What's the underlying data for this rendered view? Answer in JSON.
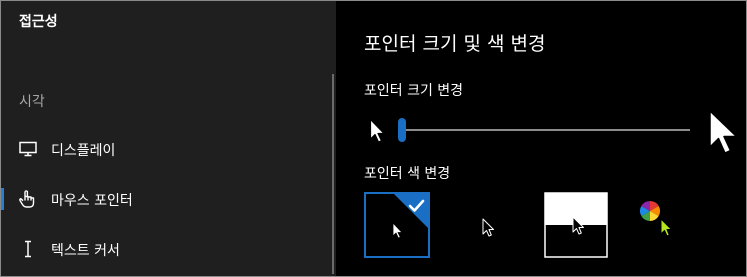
{
  "sidebar": {
    "title": "접근성",
    "section": "시각",
    "items": [
      {
        "label": "디스플레이",
        "icon": "monitor-icon",
        "active": false
      },
      {
        "label": "마우스 포인터",
        "icon": "hand-pointer-icon",
        "active": true
      },
      {
        "label": "텍스트 커서",
        "icon": "text-cursor-icon",
        "active": false
      }
    ]
  },
  "main": {
    "title": "포인터 크기 및 색 변경",
    "size_section": {
      "label": "포인터 크기 변경",
      "slider_value_fraction": 0.0
    },
    "color_section": {
      "label": "포인터 색 변경",
      "options": [
        {
          "name": "white-on-black",
          "selected": true
        },
        {
          "name": "black-outline",
          "selected": false
        },
        {
          "name": "inverted",
          "selected": false
        },
        {
          "name": "custom",
          "selected": false
        }
      ]
    }
  },
  "colors": {
    "accent": "#1a6fc4",
    "sidebar_bg": "#1f1f1f",
    "main_bg": "#000000",
    "custom_pointer": "#b5e61d"
  }
}
